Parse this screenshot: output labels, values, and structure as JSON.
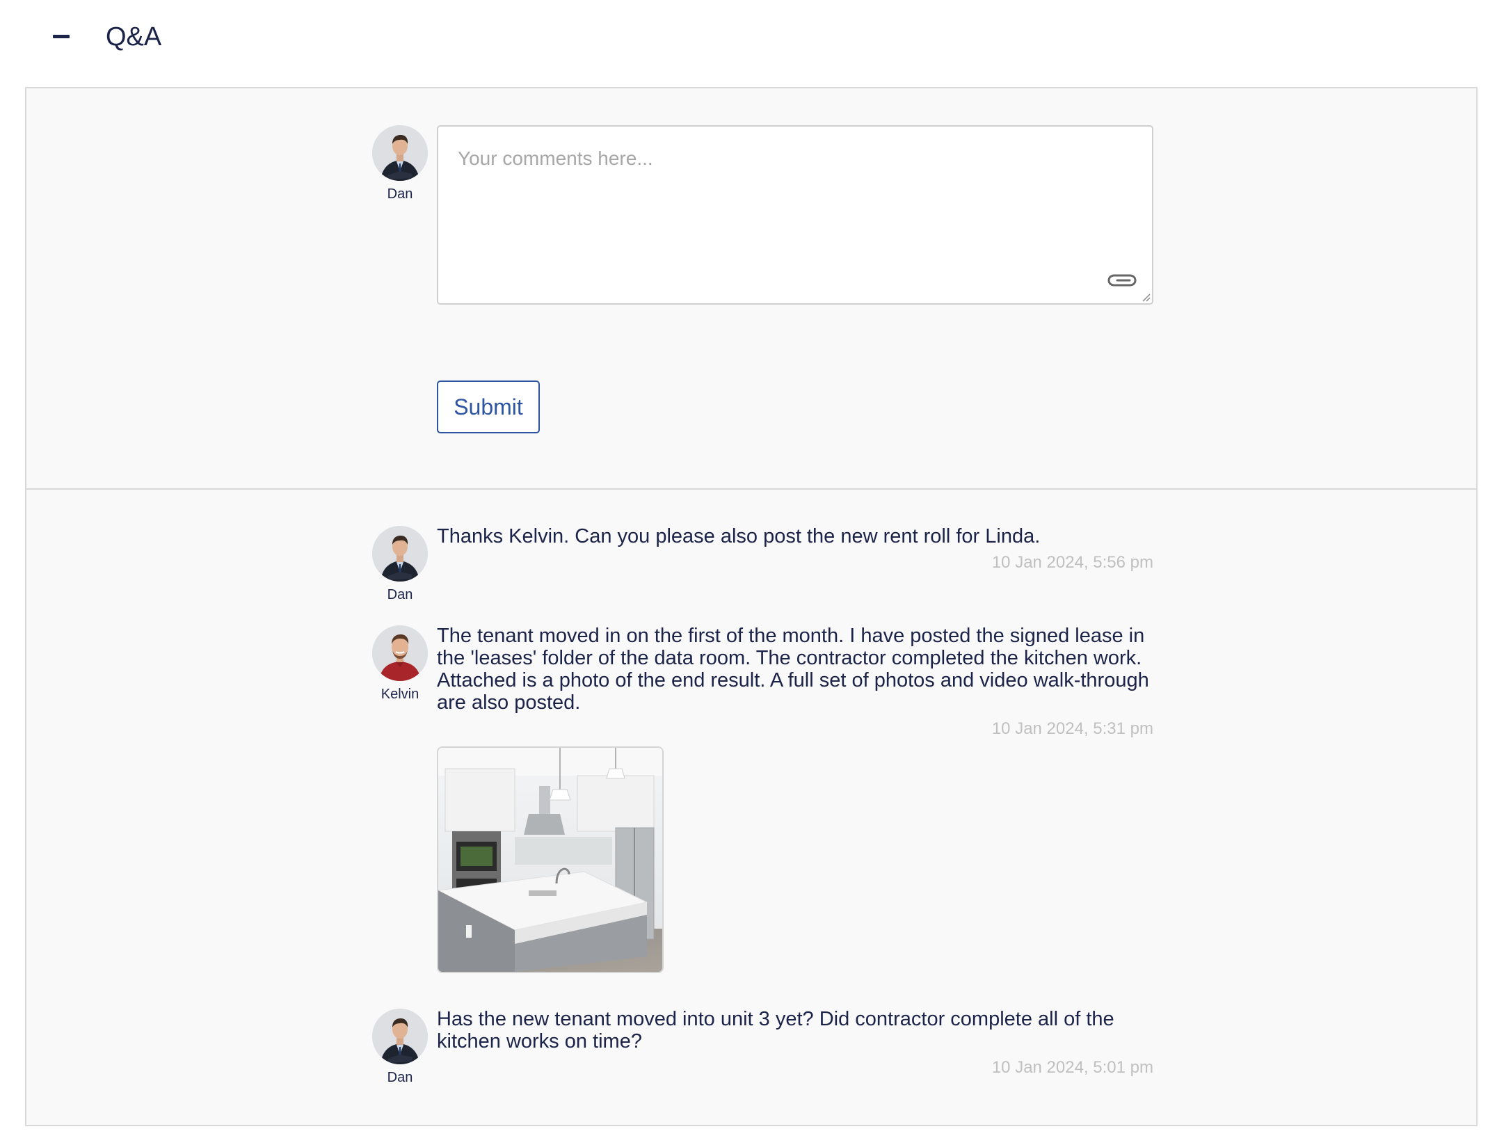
{
  "header": {
    "title": "Q&A",
    "collapse_icon": "minus-icon"
  },
  "composer": {
    "user_name": "Dan",
    "placeholder": "Your comments here...",
    "attach_icon": "paperclip-icon",
    "submit_label": "Submit"
  },
  "messages": [
    {
      "author": "Dan",
      "text": "Thanks Kelvin. Can you please also post the new rent roll for Linda.",
      "timestamp": "10 Jan 2024, 5:56 pm"
    },
    {
      "author": "Kelvin",
      "text": "The tenant moved in on the first of the month. I have posted the signed lease in the 'leases' folder of the data room. The contractor completed the kitchen work. Attached is a photo of the end result. A full set of photos and video walk-through are also posted.",
      "timestamp": "10 Jan 2024, 5:31 pm",
      "attachment": "kitchen-photo"
    },
    {
      "author": "Dan",
      "text": "Has the new tenant moved into unit 3 yet? Did contractor complete all of the kitchen works on time?",
      "timestamp": "10 Jan 2024, 5:01 pm"
    }
  ],
  "colors": {
    "text": "#1b2348",
    "accent": "#2d54a2",
    "timestamp": "#c0c0c0",
    "panel_bg": "#f9f9fa",
    "border": "#d9d9d9"
  }
}
